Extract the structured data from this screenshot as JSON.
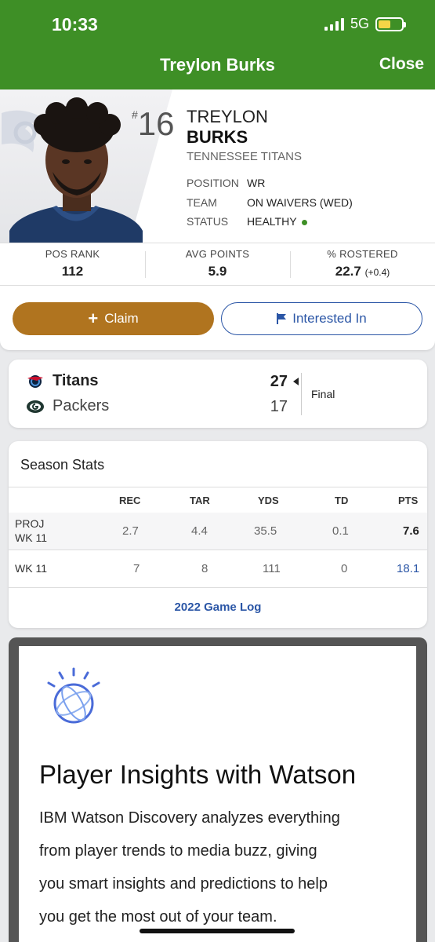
{
  "status_bar": {
    "time": "10:33",
    "network": "5G"
  },
  "header": {
    "title": "Treylon Burks",
    "close_label": "Close"
  },
  "player": {
    "jersey_prefix": "#",
    "jersey_number": "16",
    "first_name": "TREYLON",
    "last_name": "BURKS",
    "team": "TENNESSEE TITANS",
    "info": [
      {
        "label": "POSITION",
        "value": "WR"
      },
      {
        "label": "TEAM",
        "value": "ON WAIVERS (WED)"
      },
      {
        "label": "STATUS",
        "value": "HEALTHY"
      }
    ],
    "stats": [
      {
        "label": "POS RANK",
        "value": "112",
        "change": ""
      },
      {
        "label": "AVG POINTS",
        "value": "5.9",
        "change": ""
      },
      {
        "label": "% ROSTERED",
        "value": "22.7",
        "change": "(+0.4)"
      }
    ],
    "claim_label": "Claim",
    "interested_label": "Interested In"
  },
  "game": {
    "teams": [
      {
        "name": "Titans",
        "score": "27"
      },
      {
        "name": "Packers",
        "score": "17"
      }
    ],
    "status": "Final"
  },
  "season_stats": {
    "title": "Season Stats",
    "columns": [
      "REC",
      "TAR",
      "YDS",
      "TD",
      "PTS"
    ],
    "rows": [
      {
        "label_line1": "PROJ",
        "label_line2": "WK 11",
        "values": [
          "2.7",
          "4.4",
          "35.5",
          "0.1",
          "7.6"
        ]
      },
      {
        "label_line1": "WK 11",
        "label_line2": "",
        "values": [
          "7",
          "8",
          "111",
          "0",
          "18.1"
        ]
      }
    ],
    "game_log_label": "2022 Game Log"
  },
  "watson": {
    "title": "Player Insights with Watson",
    "body_lines": [
      "IBM Watson Discovery analyzes everything",
      "from player trends to media buzz, giving",
      "you smart insights and predictions to help",
      "you get the most out of your team."
    ]
  },
  "colors": {
    "header_green": "#3e8f26",
    "claim_brown": "#b0741f",
    "link_blue": "#2b56a6"
  }
}
